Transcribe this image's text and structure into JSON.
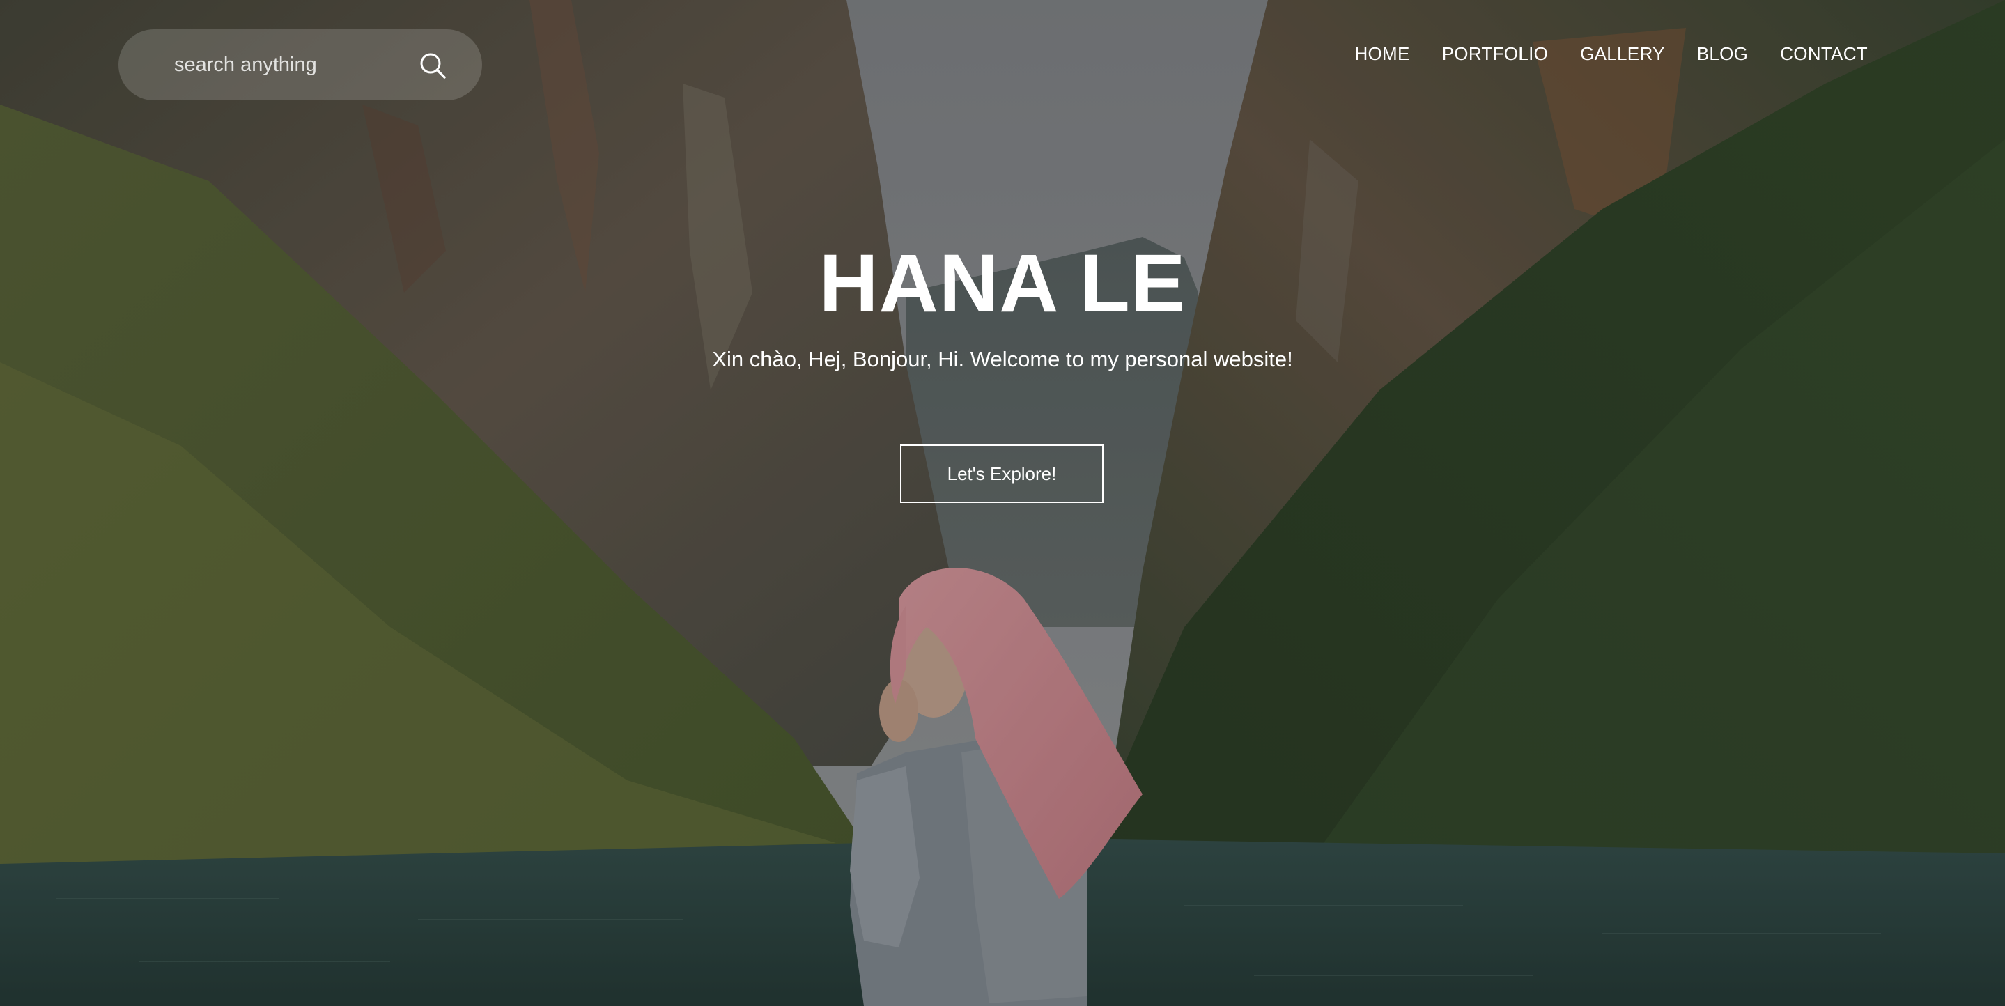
{
  "search": {
    "placeholder": "search anything",
    "icon": "search-icon"
  },
  "nav": {
    "items": [
      {
        "label": "HOME"
      },
      {
        "label": "PORTFOLIO"
      },
      {
        "label": "GALLERY"
      },
      {
        "label": "BLOG"
      },
      {
        "label": "CONTACT"
      }
    ]
  },
  "hero": {
    "title": "HANA LE",
    "subtitle": "Xin chào, Hej, Bonjour, Hi. Welcome to my personal website!",
    "cta_label": "Let's Explore!"
  },
  "colors": {
    "text": "#ffffff",
    "sky": "#8e9296",
    "water": "#2f4a46",
    "hair": "#e39aa0"
  }
}
